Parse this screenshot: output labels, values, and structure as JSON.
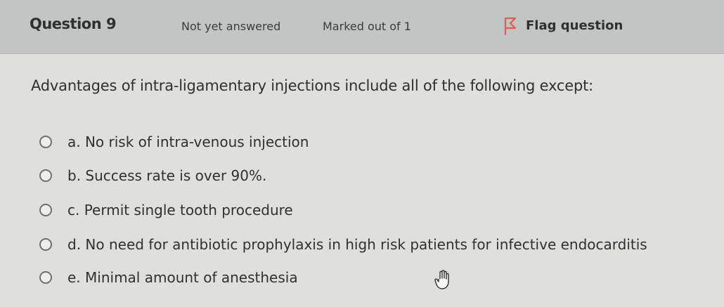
{
  "header": {
    "question_number": "Question 9",
    "state": "Not yet answered",
    "marks": "Marked out of 1",
    "flag": {
      "label": "Flag question",
      "icon": "flag-icon"
    }
  },
  "question": {
    "text": "Advantages of intra-ligamentary injections include all of the following except:",
    "answers": [
      {
        "label": "a. No risk of intra-venous injection",
        "selected": false
      },
      {
        "label": "b. Success rate is over 90%.",
        "selected": false
      },
      {
        "label": "c. Permit single tooth procedure",
        "selected": false
      },
      {
        "label": "d. No need for antibiotic prophylaxis in high risk patients for infective endocarditis",
        "selected": false
      },
      {
        "label": "e. Minimal amount of anesthesia",
        "selected": false
      }
    ]
  },
  "pointer": {
    "icon": "hand-pointer-icon"
  },
  "colors": {
    "header_background": "#c3c5c4",
    "content_background": "#dfe0dc",
    "text": "#2f3033",
    "flag_icon": "#e35d4f"
  }
}
